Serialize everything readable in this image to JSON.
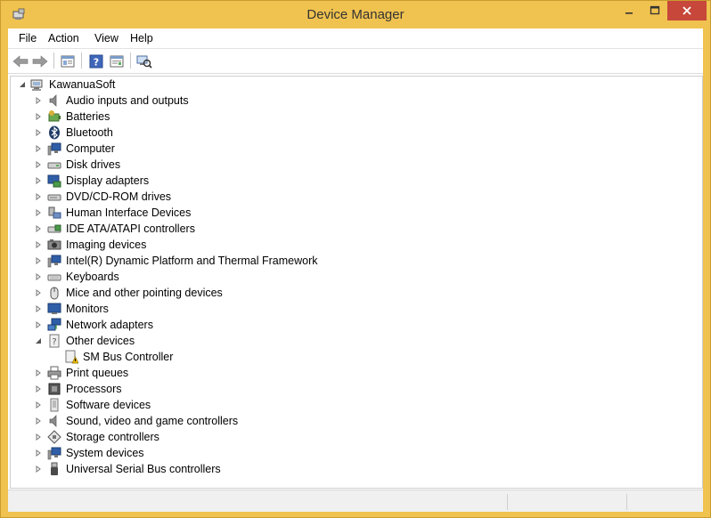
{
  "window": {
    "title": "Device Manager",
    "colors": {
      "frame": "#f0c24f",
      "close": "#c7473a"
    }
  },
  "menu": {
    "items": [
      "File",
      "Action",
      "View",
      "Help"
    ]
  },
  "toolbar": {
    "buttons": [
      "back-arrow-icon",
      "forward-arrow-icon",
      "properties-icon",
      "help-icon",
      "update-driver-icon",
      "scan-hardware-icon"
    ]
  },
  "tree": {
    "root": "KawanuaSoft",
    "items": [
      {
        "label": "Audio inputs and outputs",
        "icon": "speaker-icon"
      },
      {
        "label": "Batteries",
        "icon": "battery-icon"
      },
      {
        "label": "Bluetooth",
        "icon": "bluetooth-icon"
      },
      {
        "label": "Computer",
        "icon": "computer-icon"
      },
      {
        "label": "Disk drives",
        "icon": "disk-drive-icon"
      },
      {
        "label": "Display adapters",
        "icon": "display-adapter-icon"
      },
      {
        "label": "DVD/CD-ROM drives",
        "icon": "dvd-drive-icon"
      },
      {
        "label": "Human Interface Devices",
        "icon": "hid-icon"
      },
      {
        "label": "IDE ATA/ATAPI controllers",
        "icon": "ide-controller-icon"
      },
      {
        "label": "Imaging devices",
        "icon": "camera-icon"
      },
      {
        "label": "Intel(R) Dynamic Platform and Thermal Framework",
        "icon": "monitor-icon"
      },
      {
        "label": "Keyboards",
        "icon": "keyboard-icon"
      },
      {
        "label": "Mice and other pointing devices",
        "icon": "mouse-icon"
      },
      {
        "label": "Monitors",
        "icon": "monitor-icon"
      },
      {
        "label": "Network adapters",
        "icon": "network-icon"
      },
      {
        "label": "Other devices",
        "icon": "unknown-device-icon",
        "expanded": true,
        "children": [
          {
            "label": "SM Bus Controller",
            "icon": "warning-device-icon"
          }
        ]
      },
      {
        "label": "Print queues",
        "icon": "printer-icon"
      },
      {
        "label": "Processors",
        "icon": "processor-icon"
      },
      {
        "label": "Software devices",
        "icon": "software-device-icon"
      },
      {
        "label": "Sound, video and game controllers",
        "icon": "speaker-icon"
      },
      {
        "label": "Storage controllers",
        "icon": "storage-icon"
      },
      {
        "label": "System devices",
        "icon": "monitor-icon"
      },
      {
        "label": "Universal Serial Bus controllers",
        "icon": "usb-icon"
      }
    ]
  }
}
